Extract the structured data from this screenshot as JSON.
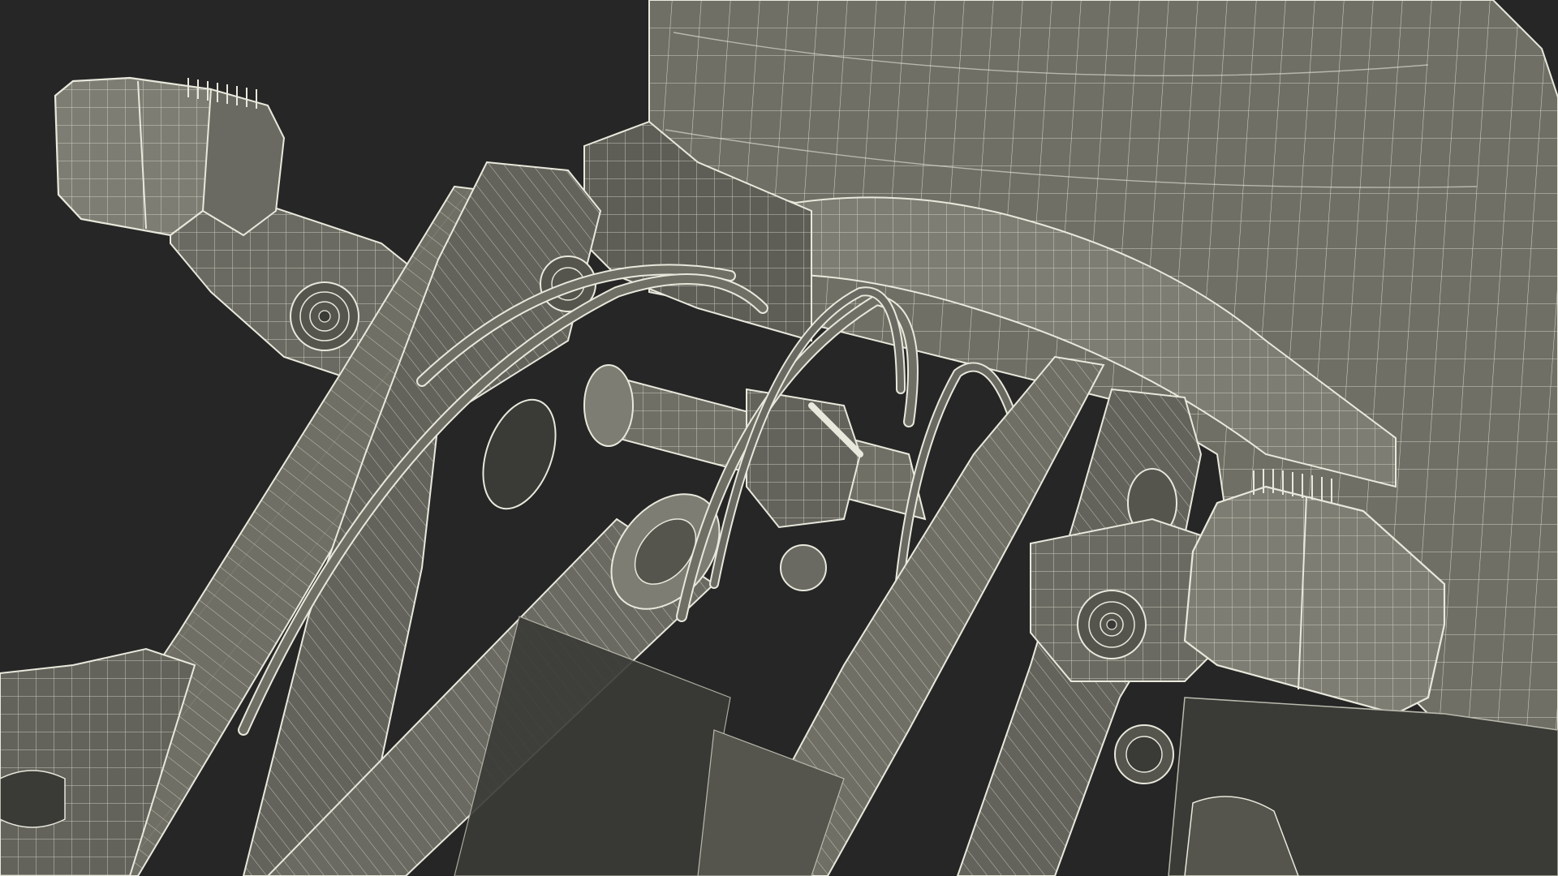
{
  "scene": {
    "subject": "wireframe-3d-render-loader-arm-assembly",
    "colors": {
      "background": "#262626",
      "surface": "#6f6f66",
      "surface_light": "#7d7d73",
      "surface_dark": "#55554e",
      "shadow": "#3a3a36",
      "wire": "#e8e8dc",
      "wire_dim": "#b9b9ad"
    }
  }
}
